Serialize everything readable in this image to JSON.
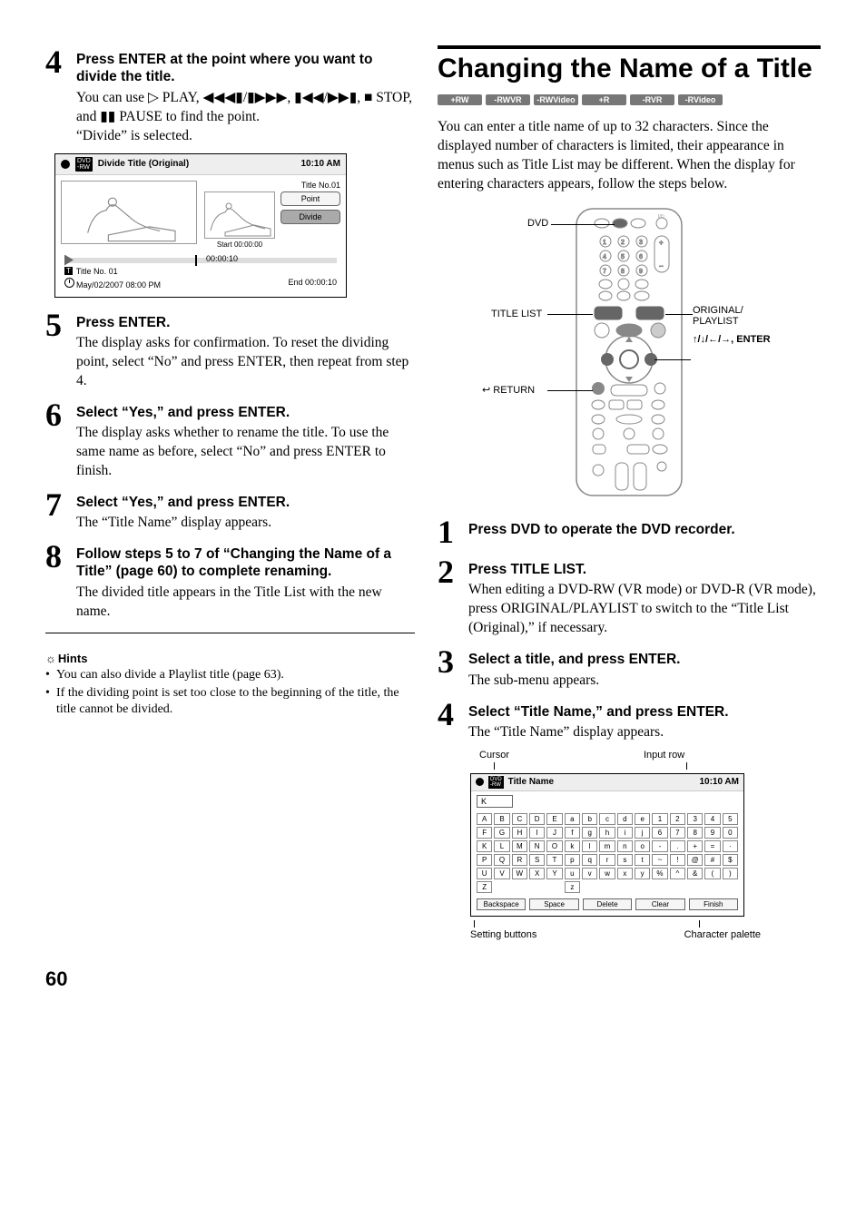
{
  "page_number": "60",
  "left": {
    "step4": {
      "title": "Press ENTER at the point where you want to divide the title.",
      "text1": "You can use ▷ PLAY, ◀◀◀▮/▮▶▶▶, ▮◀◀/▶▶▮, ■ STOP, and ▮▮ PAUSE to find the point.",
      "text2": "“Divide” is selected."
    },
    "divide_screen": {
      "header_title": "Divide Title (Original)",
      "header_time": "10:10 AM",
      "title_no": "Title No.01",
      "btn_point": "Point",
      "btn_divide": "Divide",
      "start_label": "Start 00:00:00",
      "timeline_time": "00:00:10",
      "title_no_small": "Title No. 01",
      "date": "May/02/2007  08:00  PM",
      "end_label": "End   00:00:10"
    },
    "step5": {
      "title": "Press ENTER.",
      "text": "The display asks for confirmation. To reset the dividing point, select “No” and press ENTER, then repeat from step 4."
    },
    "step6": {
      "title": "Select “Yes,” and press ENTER.",
      "text": "The display asks whether to rename the title. To use the same name as before, select “No” and press ENTER to finish."
    },
    "step7": {
      "title": "Select “Yes,” and press ENTER.",
      "text": "The “Title Name” display appears."
    },
    "step8": {
      "title": "Follow steps 5 to 7 of “Changing the Name of a Title” (page 60) to complete renaming.",
      "text": "The divided title appears in the Title List with the new name."
    },
    "hints_label": "Hints",
    "hints": [
      "You can also divide a Playlist title (page 63).",
      "If the dividing point is set too close to the beginning of the title, the title cannot be divided."
    ]
  },
  "right": {
    "heading": "Changing the Name of a Title",
    "badges": [
      "+RW",
      "-RWVR",
      "-RWVideo",
      "+R",
      "-RVR",
      "-RVideo"
    ],
    "intro": "You can enter a title name of up to 32 characters. Since the displayed number of characters is limited, their appearance in menus such as Title List may be different. When the display for entering characters appears, follow the steps below.",
    "remote": {
      "dvd": "DVD",
      "title_list": "TITLE LIST",
      "return": "RETURN",
      "original_playlist": "ORIGINAL/\nPLAYLIST",
      "arrows": "↑/↓/←/→, ENTER"
    },
    "step1": {
      "title": "Press DVD to operate the DVD recorder."
    },
    "step2": {
      "title": "Press TITLE LIST.",
      "text": "When editing a DVD-RW (VR mode) or DVD-R (VR mode), press ORIGINAL/PLAYLIST to switch to the “Title List (Original),” if necessary."
    },
    "step3": {
      "title": "Select a title, and press ENTER.",
      "text": "The sub-menu appears."
    },
    "step4": {
      "title": "Select “Title Name,” and press ENTER.",
      "text": "The “Title Name” display appears."
    },
    "annot_top": {
      "cursor": "Cursor",
      "input_row": "Input row"
    },
    "char_screen": {
      "header_title": "Title Name",
      "header_time": "10:10 AM",
      "input_value": "K",
      "rows": [
        [
          "A",
          "B",
          "C",
          "D",
          "E",
          "a",
          "b",
          "c",
          "d",
          "e",
          "1",
          "2",
          "3",
          "4",
          "5"
        ],
        [
          "F",
          "G",
          "H",
          "I",
          "J",
          "f",
          "g",
          "h",
          "i",
          "j",
          "6",
          "7",
          "8",
          "9",
          "0"
        ],
        [
          "K",
          "L",
          "M",
          "N",
          "O",
          "k",
          "l",
          "m",
          "n",
          "o",
          "-",
          ".",
          "+",
          "=",
          "·"
        ],
        [
          "P",
          "Q",
          "R",
          "S",
          "T",
          "p",
          "q",
          "r",
          "s",
          "t",
          "~",
          "!",
          "@",
          "#",
          "$"
        ],
        [
          "U",
          "V",
          "W",
          "X",
          "Y",
          "u",
          "v",
          "w",
          "x",
          "y",
          "%",
          "^",
          "&",
          "(",
          ")"
        ],
        [
          "Z",
          "",
          "",
          "",
          "",
          "z",
          "",
          "",
          "",
          "",
          "",
          "",
          "",
          "",
          ""
        ]
      ],
      "bottom": [
        "Backspace",
        "Space",
        "Delete",
        "Clear",
        "Finish"
      ]
    },
    "annot_bot": {
      "setting_buttons": "Setting buttons",
      "character_palette": "Character palette"
    }
  }
}
